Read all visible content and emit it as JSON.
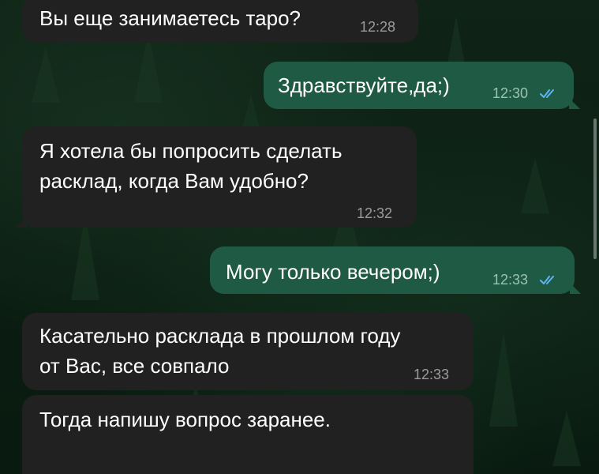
{
  "chat": {
    "messages": [
      {
        "direction": "incoming",
        "text": "Вы еще занимаетесь таро?",
        "time": "12:28"
      },
      {
        "direction": "outgoing",
        "text": "Здравствуйте,да;)",
        "time": "12:30",
        "status": "read"
      },
      {
        "direction": "incoming",
        "lines": [
          "Я хотела бы попросить сделать",
          "расклад, когда Вам удобно?"
        ],
        "time": "12:32"
      },
      {
        "direction": "outgoing",
        "text": "Могу только вечером;)",
        "time": "12:33",
        "status": "read"
      },
      {
        "direction": "incoming",
        "lines": [
          "Касательно расклада в прошлом году",
          "от Вас, все совпало"
        ],
        "time": "12:33"
      },
      {
        "direction": "incoming",
        "text": "Тогда напишу вопрос заранее."
      }
    ]
  },
  "colors": {
    "incoming_bubble": "#212121",
    "outgoing_bubble": "#1f5a45",
    "read_ticks": "#5eb5f7",
    "wallpaper": "#0b1d12"
  },
  "icons": {
    "read_status": "double-check-icon",
    "wallpaper": "forest-wallpaper"
  }
}
